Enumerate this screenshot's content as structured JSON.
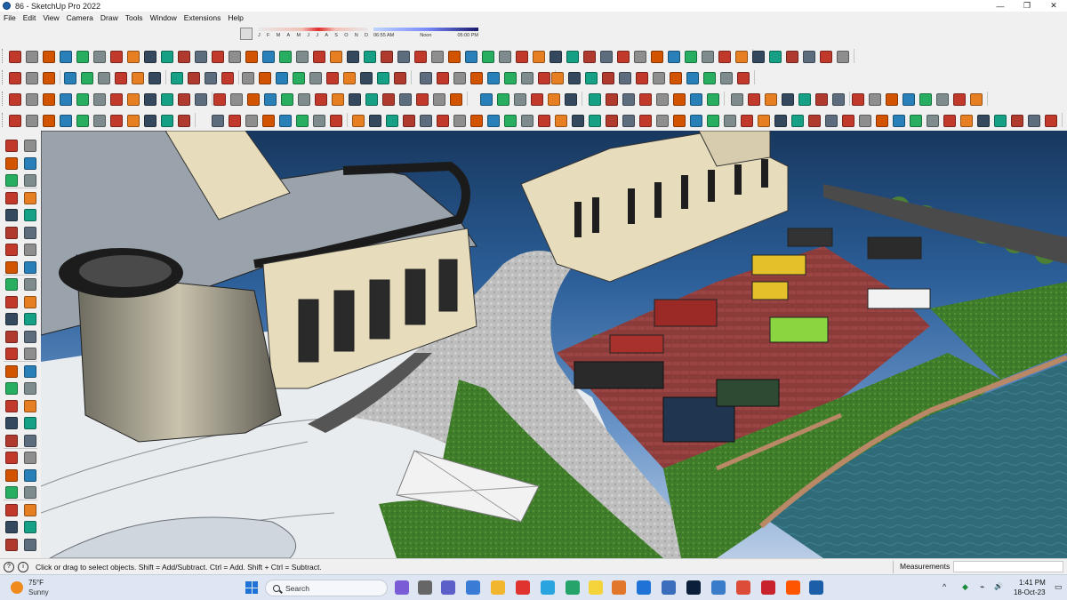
{
  "window": {
    "title": "86 - SketchUp Pro 2022",
    "controls": [
      "—",
      "❐",
      "✕"
    ]
  },
  "menu": [
    "File",
    "Edit",
    "View",
    "Camera",
    "Draw",
    "Tools",
    "Window",
    "Extensions",
    "Help"
  ],
  "shadow_widget": {
    "months": [
      "J",
      "F",
      "M",
      "A",
      "M",
      "J",
      "J",
      "A",
      "S",
      "O",
      "N",
      "D"
    ],
    "time_start": "06:55 AM",
    "time_mid": "Noon",
    "time_end": "05:00 PM"
  },
  "statusbar": {
    "hint": "Click or drag to select objects. Shift = Add/Subtract. Ctrl = Add. Shift + Ctrl = Subtract.",
    "measurements_label": "Measurements",
    "measurements_value": ""
  },
  "taskbar": {
    "weather_temp": "75°F",
    "weather_condition": "Sunny",
    "search_label": "Search",
    "time": "1:41 PM",
    "date": "18-Oct-23",
    "tray_icons": [
      "^",
      "◆",
      "⌁",
      "🔊",
      "▭"
    ]
  },
  "colors": {
    "sky_top": "#17385f",
    "lawn": "#3f7d2a",
    "water": "#2f6b79",
    "plaza": "#8b3c3a",
    "building": "#e7dcbc"
  }
}
